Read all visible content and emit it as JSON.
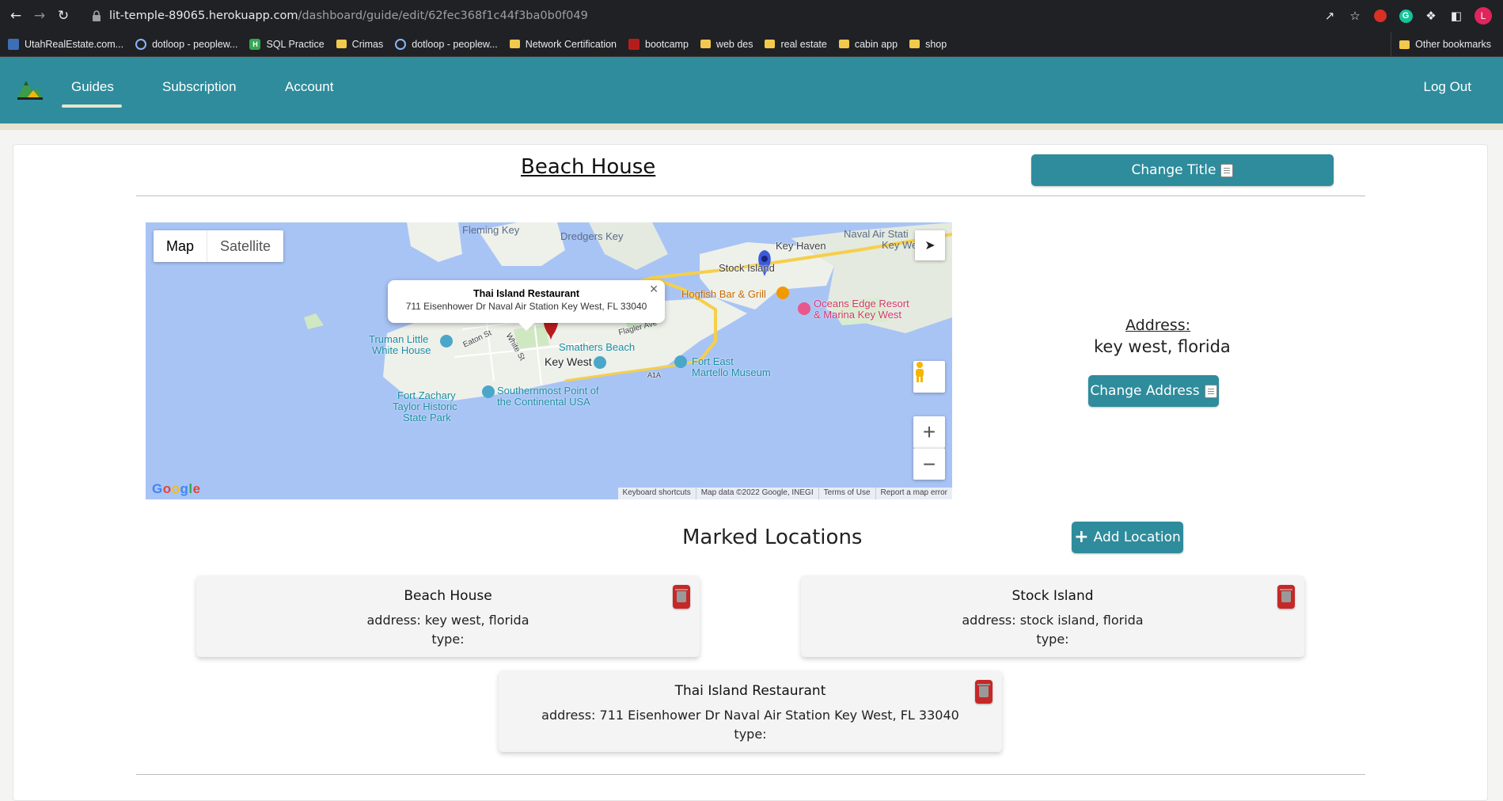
{
  "browser": {
    "url_host": "lit-temple-89065.herokuapp.com",
    "url_path": "/dashboard/guide/edit/62fec368f1c44f3ba0b0f049",
    "profile_initial": "L",
    "bookmarks": [
      "UtahRealEstate.com...",
      "dotloop - peoplew...",
      "SQL Practice",
      "Crimas",
      "dotloop - peoplew...",
      "Network Certification",
      "bootcamp",
      "web des",
      "real estate",
      "cabin app",
      "shop"
    ],
    "other_bookmarks": "Other bookmarks"
  },
  "nav": {
    "guides": "Guides",
    "subscription": "Subscription",
    "account": "Account",
    "logout": "Log Out"
  },
  "guide": {
    "title": "Beach House",
    "change_title_label": "Change Title",
    "address_label": "Address:",
    "address_value": "key west, florida",
    "change_address_label": "Change Address"
  },
  "map": {
    "map_tab": "Map",
    "satellite_tab": "Satellite",
    "infowindow_title": "Thai Island Restaurant",
    "infowindow_address": "711 Eisenhower Dr Naval Air Station Key West, FL 33040",
    "labels": {
      "fleming_key": "Fleming Key",
      "dredgers_key": "Dredgers Key",
      "naval_air": "Naval Air Stati",
      "key_we": "Key We",
      "key_haven": "Key Haven",
      "stock_island": "Stock Island",
      "hogfish": "Hogfish Bar & Grill",
      "oceans_edge_1": "Oceans Edge Resort",
      "oceans_edge_2": "& Marina Key West",
      "truman_1": "Truman Little",
      "truman_2": "White House",
      "smathers": "Smathers Beach",
      "key_west": "Key West",
      "fort_east_1": "Fort East",
      "fort_east_2": "Martello Museum",
      "fort_zachary_1": "Fort Zachary",
      "fort_zachary_2": "Taylor Historic",
      "fort_zachary_3": "State Park",
      "southernmost_1": "Southernmost Point of",
      "southernmost_2": "the Continental USA",
      "flagler": "Flagler Ave",
      "eaton": "Eaton St",
      "white": "White St",
      "a1a": "A1A"
    },
    "google": "Google",
    "footer": {
      "shortcuts": "Keyboard shortcuts",
      "mapdata": "Map data ©2022 Google, INEGI",
      "terms": "Terms of Use",
      "report": "Report a map error"
    }
  },
  "locations": {
    "heading": "Marked Locations",
    "add_label": "Add Location",
    "items": [
      {
        "name": "Beach House",
        "address": "address: key west, florida",
        "type": "type:"
      },
      {
        "name": "Stock Island",
        "address": "address: stock island, florida",
        "type": "type:"
      },
      {
        "name": "Thai Island Restaurant",
        "address": "address: 711 Eisenhower Dr Naval Air Station Key West, FL 33040",
        "type": "type:"
      }
    ]
  },
  "colors": {
    "brand_teal": "#2e8c9c",
    "trash_red": "#c62828",
    "water": "#a8c4f5"
  }
}
